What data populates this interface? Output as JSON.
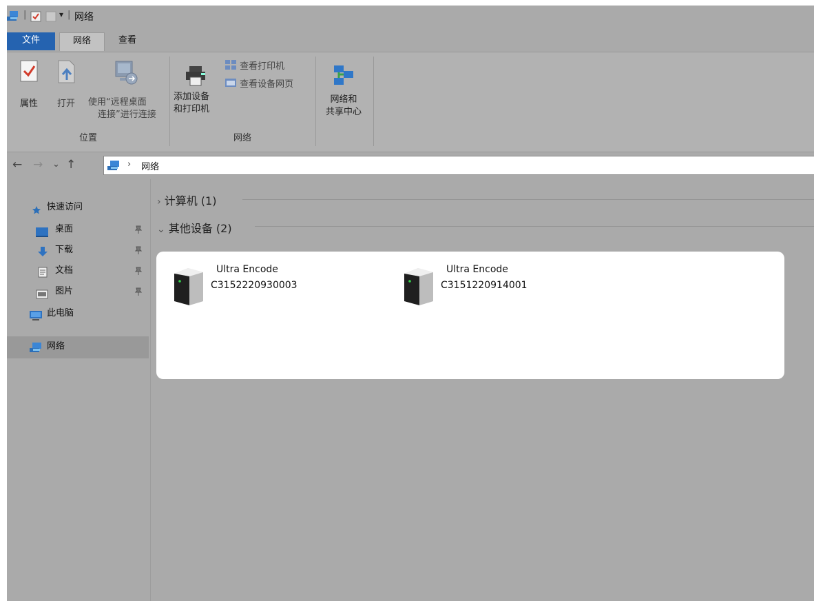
{
  "titlebar": {
    "title": "网络",
    "separator": "|",
    "quick_access_dropdown": "▾"
  },
  "tabs": [
    {
      "label": "文件"
    },
    {
      "label": "网络"
    },
    {
      "label": "查看"
    }
  ],
  "ribbon": {
    "groups": [
      {
        "label": "位置"
      },
      {
        "label": "网络"
      }
    ],
    "buttons": {
      "properties": "属性",
      "open": "打开",
      "remote_line1": "使用“远程桌面",
      "remote_line2": "连接”进行连接",
      "add_device_line1": "添加设备",
      "add_device_line2": "和打印机",
      "view_printers": "查看打印机",
      "view_device_webpage": "查看设备网页",
      "nsc_line1": "网络和",
      "nsc_line2": "共享中心"
    }
  },
  "nav": {
    "back": "←",
    "forward": "→",
    "recent": "⌄",
    "up": "↑",
    "breadcrumb_sep": "›",
    "location": "网络"
  },
  "sidebar": {
    "items": [
      {
        "label": "快速访问",
        "icon": "star-icon"
      },
      {
        "label": "桌面",
        "icon": "desktop-folder-icon",
        "pinned": true
      },
      {
        "label": "下载",
        "icon": "download-icon",
        "pinned": true
      },
      {
        "label": "文档",
        "icon": "document-icon",
        "pinned": true
      },
      {
        "label": "图片",
        "icon": "picture-icon",
        "pinned": true
      },
      {
        "label": "此电脑",
        "icon": "computer-icon"
      },
      {
        "label": "网络",
        "icon": "network-icon",
        "selected": true
      }
    ],
    "pin_glyph": "📌"
  },
  "content": {
    "sections": [
      {
        "chevron": "›",
        "label": "计算机 (1)",
        "expanded": false
      },
      {
        "chevron": "⌄",
        "label": "其他设备 (2)",
        "expanded": true
      }
    ],
    "devices": [
      {
        "name": "Ultra Encode",
        "id": "C3152220930003",
        "icon": "server-tower-icon"
      },
      {
        "name": "Ultra Encode",
        "id": "C3151220914001",
        "icon": "server-tower-icon"
      }
    ]
  },
  "colors": {
    "accent": "#2563b0",
    "window_bg": "#aaaaaa",
    "ribbon_bg": "#b2b2b2",
    "selected_bg": "#999999"
  }
}
